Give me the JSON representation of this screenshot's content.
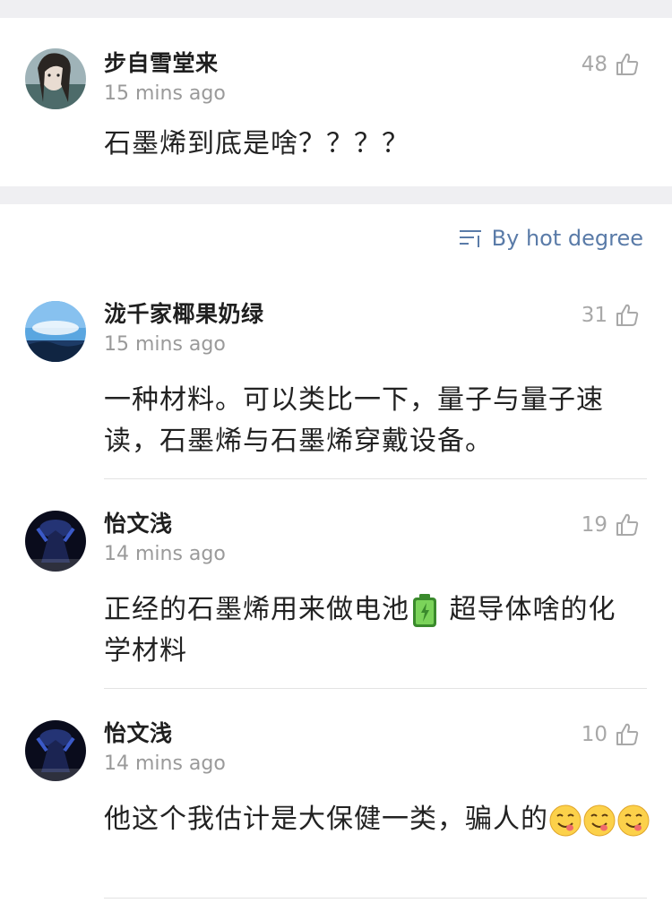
{
  "pinned_comment": {
    "user": "步自雪堂来",
    "time": "15 mins ago",
    "likes": "48",
    "text": "石墨烯到底是啥？？？？"
  },
  "sort": {
    "label": "By hot degree"
  },
  "comments": [
    {
      "user": "泷千家椰果奶绿",
      "time": "15 mins ago",
      "likes": "31",
      "text": "一种材料。可以类比一下，量子与量子速读，石墨烯与石墨烯穿戴设备。"
    },
    {
      "user": "怡文浅",
      "time": "14 mins ago",
      "likes": "19",
      "text_a": "正经的石墨烯用来做电池",
      "text_b": " 超导体啥的化学材料"
    },
    {
      "user": "怡文浅",
      "time": "14 mins ago",
      "likes": "10",
      "text": "他这个我估计是大保健一类，骗人的"
    }
  ],
  "icons": {
    "like": "thumbs-up-outline-icon",
    "sort": "sort-lines-icon",
    "battery": "battery-emoji-icon",
    "face": "face-savoring-emoji-icon"
  },
  "colors": {
    "accent": "#5a7ba8",
    "muted": "#9a9a9a",
    "separator": "#efeff2"
  }
}
